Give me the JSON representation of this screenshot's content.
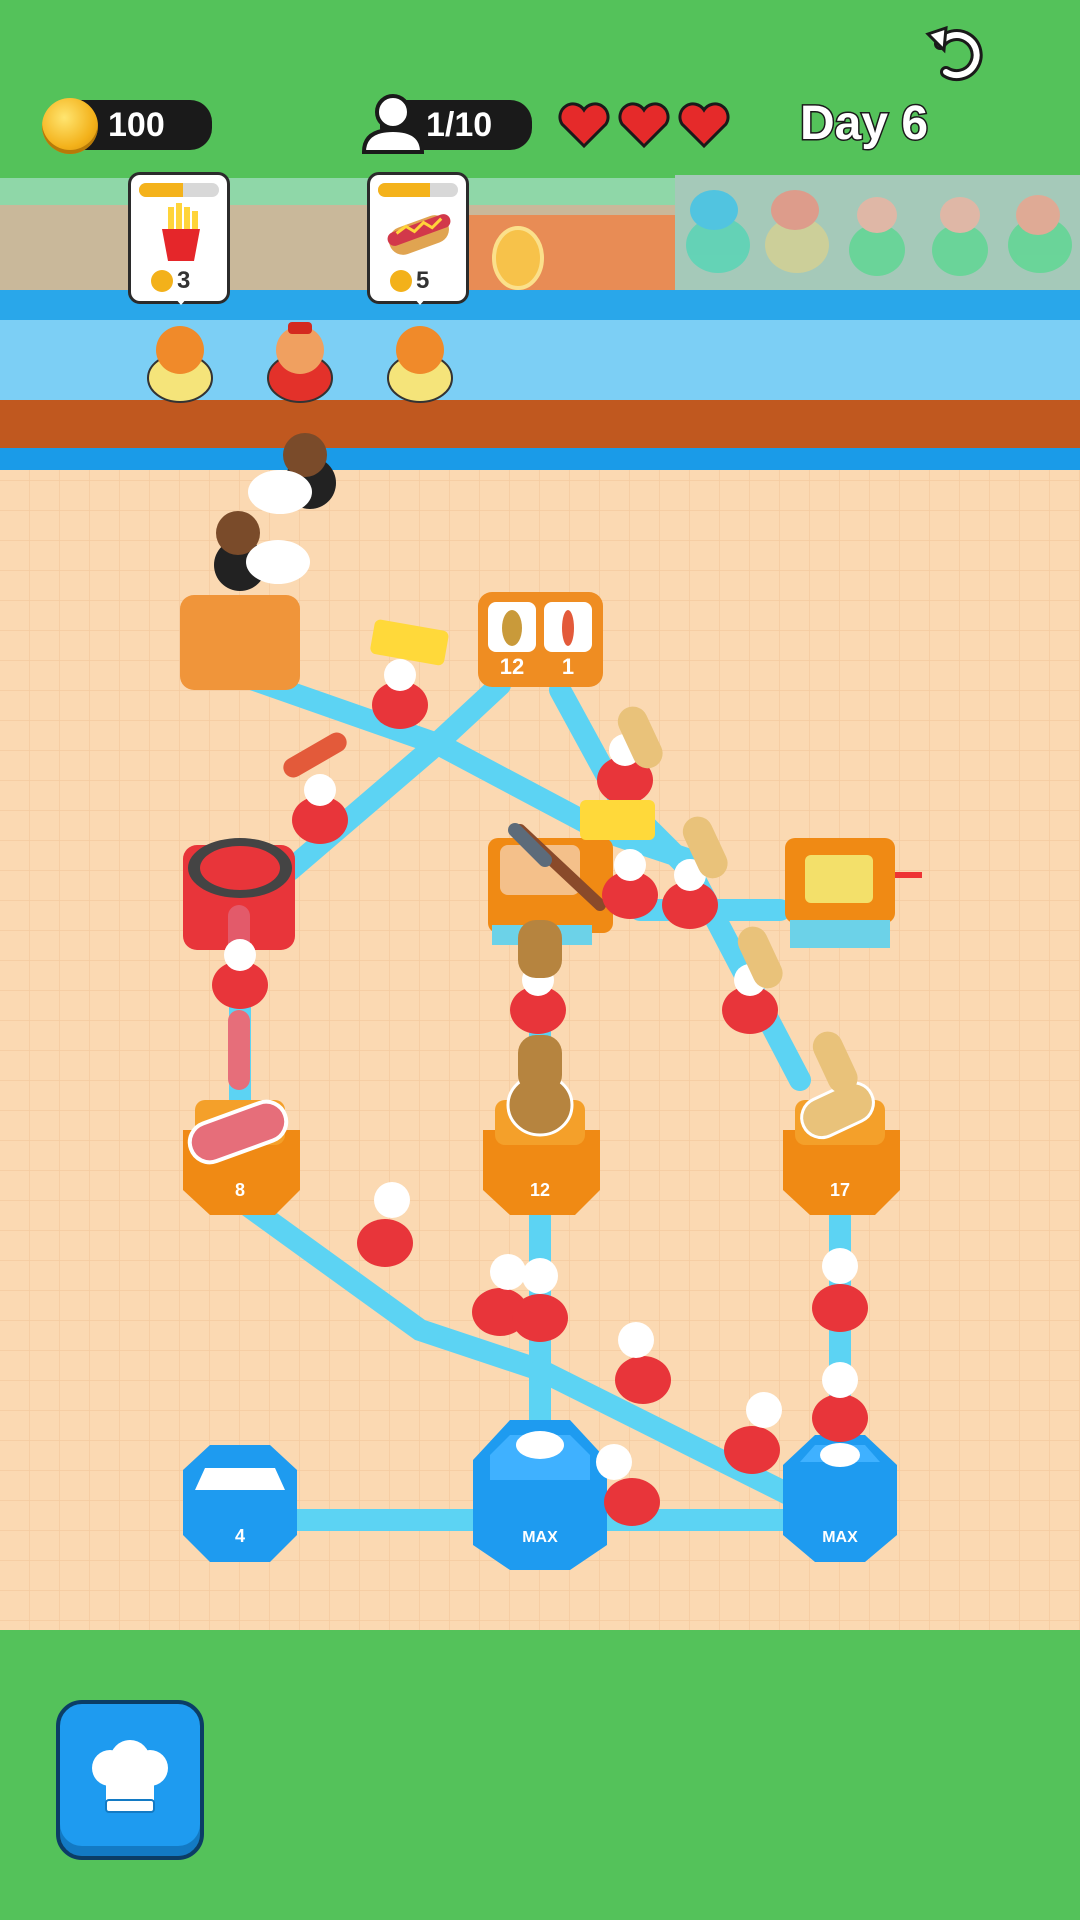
{
  "hud": {
    "coins": "100",
    "customers": "1/10",
    "lives": 3,
    "day": "Day 6"
  },
  "orders": [
    {
      "item": "fries",
      "price": "3",
      "progress": 0.55
    },
    {
      "item": "hotdog",
      "price": "5",
      "progress": 0.65
    }
  ],
  "serving_station": {
    "hotdog_bun_count": "12",
    "sausage_count": "1"
  },
  "stations": [
    {
      "name": "sausage-crate",
      "level": "8"
    },
    {
      "name": "potato-crate",
      "level": "12"
    },
    {
      "name": "bun-crate",
      "level": "17"
    },
    {
      "name": "chef-spawner-1",
      "level": "4"
    },
    {
      "name": "chef-spawner-2",
      "level": "MAX"
    },
    {
      "name": "chef-spawner-3",
      "level": "MAX"
    }
  ],
  "colors": {
    "grass": "#54c25a",
    "floor": "#f9d8b0",
    "path": "#5cd3f3",
    "station_blue": "#1e9bf0",
    "station_orange": "#f08a14"
  },
  "icons": [
    "undo-icon",
    "coin-icon",
    "person-icon",
    "heart-icon",
    "chef-hat-icon"
  ]
}
